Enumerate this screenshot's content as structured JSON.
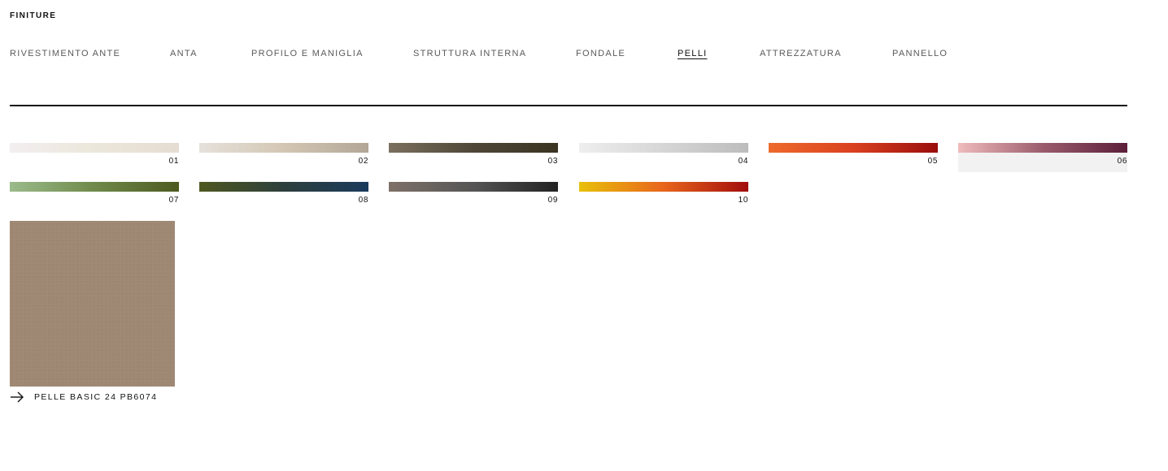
{
  "header": {
    "title": "FINITURE"
  },
  "tabs": [
    {
      "label": "RIVESTIMENTO ANTE",
      "active": false
    },
    {
      "label": "ANTA",
      "active": false
    },
    {
      "label": "PROFILO E MANIGLIA",
      "active": false
    },
    {
      "label": "STRUTTURA INTERNA",
      "active": false
    },
    {
      "label": "FONDALE",
      "active": false
    },
    {
      "label": "PELLI",
      "active": true
    },
    {
      "label": "ATTREZZATURA",
      "active": false
    },
    {
      "label": "PANNELLO",
      "active": false
    }
  ],
  "swatches": [
    {
      "number": "01",
      "colors": [
        "#f3eef0",
        "#ebe7da",
        "#e6dcd2"
      ],
      "selected": false
    },
    {
      "number": "02",
      "colors": [
        "#e6e1dc",
        "#d3c7b3",
        "#b2a697"
      ],
      "selected": false
    },
    {
      "number": "03",
      "colors": [
        "#7b7060",
        "#4f4637",
        "#3a3322"
      ],
      "selected": false
    },
    {
      "number": "04",
      "colors": [
        "#eeeeee",
        "#d6d6d6",
        "#bcbcbc"
      ],
      "selected": false
    },
    {
      "number": "05",
      "colors": [
        "#ee6a2c",
        "#d9411f",
        "#9a0d0b"
      ],
      "selected": false
    },
    {
      "number": "06",
      "colors": [
        "#f0bcbc",
        "#9a5c6c",
        "#5c1e3a"
      ],
      "selected": true
    },
    {
      "number": "07",
      "colors": [
        "#9bbb8b",
        "#6f8a4a",
        "#4d5a1f"
      ],
      "selected": false
    },
    {
      "number": "08",
      "colors": [
        "#4e5820",
        "#2d3f3d",
        "#1a3a5c"
      ],
      "selected": false
    },
    {
      "number": "09",
      "colors": [
        "#7e7168",
        "#555555",
        "#222222"
      ],
      "selected": false
    },
    {
      "number": "10",
      "colors": [
        "#e8c00a",
        "#e8651c",
        "#a10c0c"
      ],
      "selected": false
    }
  ],
  "preview": {
    "color": "#9e8772",
    "caption": "PELLE BASIC 24 PB6074",
    "icon": "arrow-right-icon"
  }
}
